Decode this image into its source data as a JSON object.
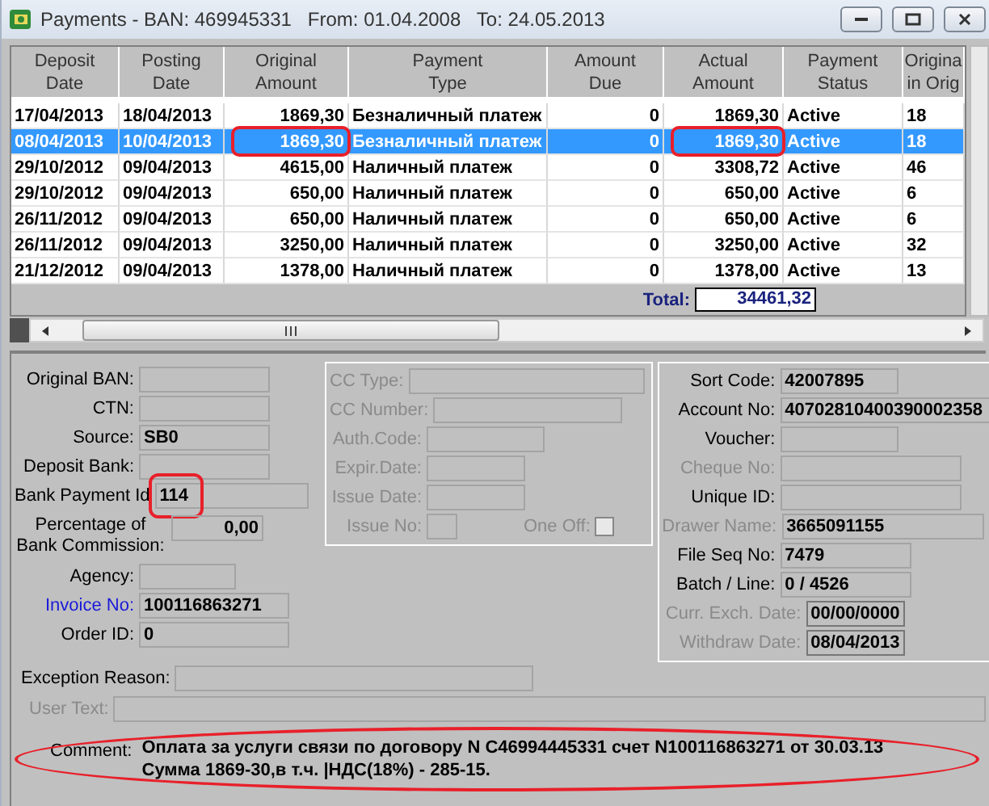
{
  "window": {
    "title": "Payments - BAN: 469945331   From: 01.04.2008   To: 24.05.2013"
  },
  "table": {
    "columns": [
      {
        "lines": [
          "Deposit",
          "Date"
        ]
      },
      {
        "lines": [
          "Posting",
          "Date"
        ]
      },
      {
        "lines": [
          "Original",
          "Amount"
        ]
      },
      {
        "lines": [
          "Payment",
          "Type"
        ]
      },
      {
        "lines": [
          "Amount",
          "Due"
        ]
      },
      {
        "lines": [
          "Actual",
          "Amount"
        ]
      },
      {
        "lines": [
          "Payment",
          "Status"
        ]
      },
      {
        "lines": [
          "Origina",
          "in Orig"
        ]
      }
    ],
    "rows": [
      {
        "selected": false,
        "cells": [
          {
            "text": "17/04/2013",
            "outlined": false
          },
          {
            "text": "18/04/2013",
            "outlined": false
          },
          {
            "text": "1869,30",
            "outlined": false
          },
          {
            "text": "Безналичный платеж",
            "outlined": false
          },
          {
            "text": "0",
            "outlined": false
          },
          {
            "text": "1869,30",
            "outlined": false
          },
          {
            "text": "Active",
            "outlined": false
          },
          {
            "text": "18",
            "outlined": false
          }
        ]
      },
      {
        "selected": true,
        "cells": [
          {
            "text": "08/04/2013",
            "outlined": false
          },
          {
            "text": "10/04/2013",
            "outlined": false
          },
          {
            "text": "1869,30",
            "outlined": true
          },
          {
            "text": "Безналичный платеж",
            "outlined": false
          },
          {
            "text": "0",
            "outlined": false
          },
          {
            "text": "1869,30",
            "outlined": true
          },
          {
            "text": "Active",
            "outlined": false
          },
          {
            "text": "18",
            "outlined": false
          }
        ]
      },
      {
        "selected": false,
        "cells": [
          {
            "text": "29/10/2012",
            "outlined": false
          },
          {
            "text": "09/04/2013",
            "outlined": false
          },
          {
            "text": "4615,00",
            "outlined": false
          },
          {
            "text": "Наличный платеж",
            "outlined": false
          },
          {
            "text": "0",
            "outlined": false
          },
          {
            "text": "3308,72",
            "outlined": false
          },
          {
            "text": "Active",
            "outlined": false
          },
          {
            "text": "46",
            "outlined": false
          }
        ]
      },
      {
        "selected": false,
        "cells": [
          {
            "text": "29/10/2012",
            "outlined": false
          },
          {
            "text": "09/04/2013",
            "outlined": false
          },
          {
            "text": "650,00",
            "outlined": false
          },
          {
            "text": "Наличный платеж",
            "outlined": false
          },
          {
            "text": "0",
            "outlined": false
          },
          {
            "text": "650,00",
            "outlined": false
          },
          {
            "text": "Active",
            "outlined": false
          },
          {
            "text": "6",
            "outlined": false
          }
        ]
      },
      {
        "selected": false,
        "cells": [
          {
            "text": "26/11/2012",
            "outlined": false
          },
          {
            "text": "09/04/2013",
            "outlined": false
          },
          {
            "text": "650,00",
            "outlined": false
          },
          {
            "text": "Наличный платеж",
            "outlined": false
          },
          {
            "text": "0",
            "outlined": false
          },
          {
            "text": "650,00",
            "outlined": false
          },
          {
            "text": "Active",
            "outlined": false
          },
          {
            "text": "6",
            "outlined": false
          }
        ]
      },
      {
        "selected": false,
        "cells": [
          {
            "text": "26/11/2012",
            "outlined": false
          },
          {
            "text": "09/04/2013",
            "outlined": false
          },
          {
            "text": "3250,00",
            "outlined": false
          },
          {
            "text": "Наличный платеж",
            "outlined": false
          },
          {
            "text": "0",
            "outlined": false
          },
          {
            "text": "3250,00",
            "outlined": false
          },
          {
            "text": "Active",
            "outlined": false
          },
          {
            "text": "32",
            "outlined": false
          }
        ]
      },
      {
        "selected": false,
        "cells": [
          {
            "text": "21/12/2012",
            "outlined": false
          },
          {
            "text": "09/04/2013",
            "outlined": false
          },
          {
            "text": "1378,00",
            "outlined": false
          },
          {
            "text": "Наличный платеж",
            "outlined": false
          },
          {
            "text": "0",
            "outlined": false
          },
          {
            "text": "1378,00",
            "outlined": false
          },
          {
            "text": "Active",
            "outlined": false
          },
          {
            "text": "13",
            "outlined": false
          }
        ]
      }
    ],
    "total": {
      "label": "Total:",
      "value": "34461,32"
    }
  },
  "details": {
    "fields": [
      {
        "kind": "field",
        "label": "Original BAN:",
        "disabled": false,
        "outlined": false
      },
      {
        "kind": "field",
        "label": "CTN:",
        "disabled": false,
        "outlined": false
      },
      {
        "kind": "field",
        "label": "Source:",
        "value": "SB0",
        "disabled": false,
        "outlined": false
      },
      {
        "kind": "field",
        "label": "Deposit Bank:",
        "disabled": false,
        "outlined": false
      },
      {
        "kind": "field",
        "label": "Bank Payment Id",
        "value": "114",
        "disabled": false,
        "outlined": true
      },
      {
        "kind": "percent",
        "lines": [
          "Percentage of",
          "Bank Commission:"
        ],
        "value": "0,00",
        "disabled": false,
        "outlined": false
      },
      {
        "kind": "field",
        "label": "Agency:",
        "disabled": false,
        "outlined": false
      },
      {
        "kind": "link",
        "label": "Invoice No:",
        "value": "100116863271",
        "disabled": false,
        "outlined": false
      },
      {
        "kind": "field",
        "label": "Order ID:",
        "value": "0",
        "disabled": false,
        "outlined": false
      }
    ],
    "card": [
      {
        "label": "CC Type:",
        "disabled": true
      },
      {
        "label": "CC Number:",
        "disabled": true
      },
      {
        "label": "Auth.Code:",
        "disabled": true
      },
      {
        "label": "Expir.Date:",
        "disabled": true
      },
      {
        "label": "Issue Date:",
        "disabled": true
      },
      {
        "label": "Issue No:",
        "disabled": true,
        "checkbox": {
          "label": "One Off:",
          "checked": false
        }
      }
    ],
    "bank": [
      {
        "kind": "field",
        "label": "Sort Code:",
        "value": "42007895",
        "disabled": false
      },
      {
        "kind": "field",
        "label": "Account No:",
        "value": "40702810400390002358",
        "disabled": false
      },
      {
        "kind": "field",
        "label": "Voucher:",
        "disabled": false
      },
      {
        "kind": "field",
        "label": "Cheque No:",
        "disabled": true
      },
      {
        "kind": "field",
        "label": "Unique ID:",
        "disabled": false
      },
      {
        "kind": "field",
        "label": "Drawer Name:",
        "value": "3665091155",
        "disabled": true
      },
      {
        "kind": "field",
        "label": "File Seq No:",
        "value": "7479",
        "disabled": false
      },
      {
        "kind": "field",
        "label": "Batch / Line:",
        "value": "0 / 4526",
        "disabled": false
      },
      {
        "kind": "date",
        "label": "Curr. Exch. Date:",
        "value": "00/00/0000",
        "disabled": true
      },
      {
        "kind": "date",
        "label": "Withdraw Date:",
        "value": "08/04/2013",
        "disabled": true
      }
    ],
    "exception_reason": {
      "label": "Exception Reason:",
      "disabled": false
    },
    "user_text": {
      "label": "User Text:",
      "disabled": true
    },
    "comment": {
      "label": "Comment:",
      "text": "Оплата за услуги связи по договору N C46994445331 счет N100116863271 от 30.03.13 Сумма 1869-30,в т.ч. |НДС(18%) - 285-15.",
      "outlined": true
    }
  }
}
